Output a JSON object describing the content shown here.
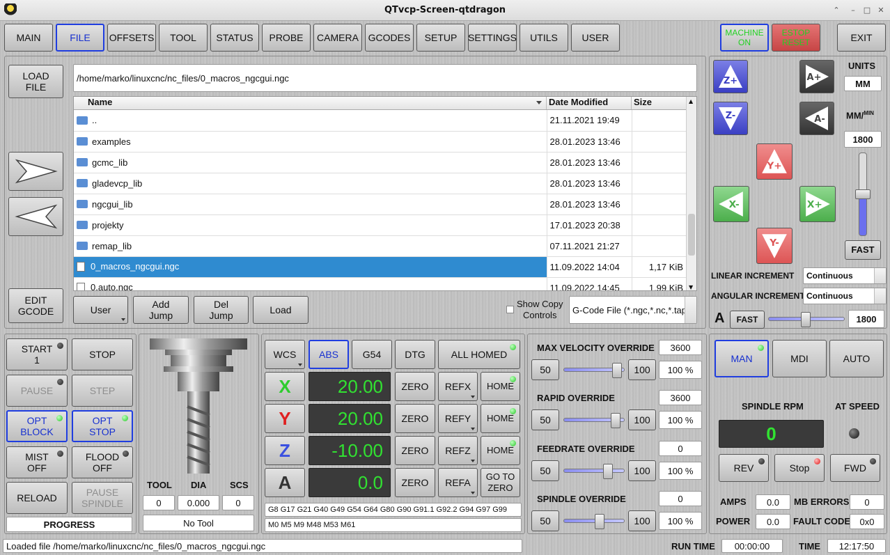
{
  "window": {
    "title": "QTvcp-Screen-qtdragon"
  },
  "tabs": {
    "main": "MAIN",
    "file": "FILE",
    "offsets": "OFFSETS",
    "tool": "TOOL",
    "status": "STATUS",
    "probe": "PROBE",
    "camera": "CAMERA",
    "gcodes": "GCODES",
    "setup": "SETUP",
    "settings": "SETTINGS",
    "utils": "UTILS",
    "user": "USER"
  },
  "top": {
    "machine_on": "MACHINE\nON",
    "estop": "ESTOP\nRESET",
    "exit": "EXIT"
  },
  "file": {
    "load_file": "LOAD\nFILE",
    "edit_gcode": "EDIT\nGCODE",
    "path": "/home/marko/linuxcnc/nc_files/0_macros_ngcgui.ngc",
    "columns": {
      "name": "Name",
      "date": "Date Modified",
      "size": "Size"
    },
    "rows": [
      {
        "name": "..",
        "date": "21.11.2021 19:49",
        "size": "",
        "type": "folder"
      },
      {
        "name": "examples",
        "date": "28.01.2023 13:46",
        "size": "",
        "type": "folder"
      },
      {
        "name": "gcmc_lib",
        "date": "28.01.2023 13:46",
        "size": "",
        "type": "folder"
      },
      {
        "name": "gladevcp_lib",
        "date": "28.01.2023 13:46",
        "size": "",
        "type": "folder"
      },
      {
        "name": "ngcgui_lib",
        "date": "28.01.2023 13:46",
        "size": "",
        "type": "folder"
      },
      {
        "name": "projekty",
        "date": "17.01.2023 20:38",
        "size": "",
        "type": "folder"
      },
      {
        "name": "remap_lib",
        "date": "07.11.2021 21:27",
        "size": "",
        "type": "folder"
      },
      {
        "name": "0_macros_ngcgui.ngc",
        "date": "11.09.2022 14:04",
        "size": "1,17 KiB",
        "type": "file",
        "selected": true
      },
      {
        "name": "0.auto.ngc",
        "date": "11.09.2022 14:45",
        "size": "1,99 KiB",
        "type": "file"
      }
    ],
    "user": "User",
    "add_jump": "Add\nJump",
    "del_jump": "Del\nJump",
    "load": "Load",
    "show_copy": "Show Copy\nControls",
    "filter": "G-Code File (*.ngc,*.nc,*.tap"
  },
  "jog": {
    "units_label": "UNITS",
    "units": "MM",
    "rate_label": "MM/",
    "rate_sup": "MIN",
    "rate": "1800",
    "fast": "FAST",
    "linear_label": "LINEAR INCREMENT",
    "linear": "Continuous",
    "angular_label": "ANGULAR INCREMENT",
    "angular": "Continuous",
    "a_label": "A",
    "a_fast": "FAST",
    "a_rate": "1800",
    "zplus": "Z+",
    "zminus": "Z-",
    "aplus": "A+",
    "aminus": "A-",
    "yplus": "Y+",
    "yminus": "Y-",
    "xplus": "X+",
    "xminus": "X-",
    "rate_slider": 0.55,
    "a_slider": 0.42
  },
  "controls": {
    "start": "START\n1",
    "stop": "STOP",
    "pause": "PAUSE",
    "step": "STEP",
    "opt_block": "OPT\nBLOCK",
    "opt_stop": "OPT\nSTOP",
    "mist": "MIST\nOFF",
    "flood": "FLOOD\nOFF",
    "reload": "RELOAD",
    "pause_spindle": "PAUSE\nSPINDLE",
    "progress": "PROGRESS"
  },
  "tool": {
    "tool_label": "TOOL",
    "dia_label": "DIA",
    "scs_label": "SCS",
    "tool": "0",
    "dia": "0.000",
    "scs": "0",
    "name": "No Tool"
  },
  "dro": {
    "wcs": "WCS",
    "abs": "ABS",
    "g54": "G54",
    "dtg": "DTG",
    "all_homed": "ALL HOMED",
    "axes": [
      {
        "axis": "X",
        "value": "20.00",
        "ref": "REFX",
        "home": "HOME",
        "color": "#2ecc2e"
      },
      {
        "axis": "Y",
        "value": "20.00",
        "ref": "REFY",
        "home": "HOME",
        "color": "#e02020"
      },
      {
        "axis": "Z",
        "value": "-10.00",
        "ref": "REFZ",
        "home": "HOME",
        "color": "#3a50e0"
      },
      {
        "axis": "A",
        "value": "0.0",
        "ref": "REFA",
        "home": "GO TO\nZERO",
        "color": "#333333"
      }
    ],
    "zero": "ZERO",
    "gcodes": "G8 G17 G21 G40 G49 G54 G64 G80 G90 G91.1 G92.2 G94 G97 G99",
    "mcodes": "M0 M5 M9 M48 M53 M61"
  },
  "overrides": {
    "max_vel_label": "MAX VELOCITY OVERRIDE",
    "max_vel": "3600",
    "max_vel_pct": "100 %",
    "max_vel_pos": 0.93,
    "rapid_label": "RAPID OVERRIDE",
    "rapid": "3600",
    "rapid_pct": "100 %",
    "rapid_pos": 0.9,
    "feed_label": "FEEDRATE OVERRIDE",
    "feed": "0",
    "feed_pct": "100 %",
    "feed_pos": 0.75,
    "spindle_label": "SPINDLE OVERRIDE",
    "spindle": "0",
    "spindle_pct": "100 %",
    "spindle_pos": 0.6,
    "low": "50",
    "high": "100"
  },
  "mode": {
    "man": "MAN",
    "mdi": "MDI",
    "auto": "AUTO",
    "spindle_rpm_label": "SPINDLE RPM",
    "at_speed": "AT SPEED",
    "rpm": "0",
    "rev": "REV",
    "stop": "Stop",
    "fwd": "FWD",
    "amps_label": "AMPS",
    "amps": "0.0",
    "mb_label": "MB ERRORS",
    "mb": "0",
    "power_label": "POWER",
    "power": "0.0",
    "fault_label": "FAULT CODE",
    "fault": "0x0"
  },
  "status": {
    "message": "Loaded file /home/marko/linuxcnc/nc_files/0_macros_ngcgui.ngc",
    "runtime_label": "RUN TIME",
    "runtime": "00:00:00",
    "time_label": "TIME",
    "time": "12:17:50"
  }
}
